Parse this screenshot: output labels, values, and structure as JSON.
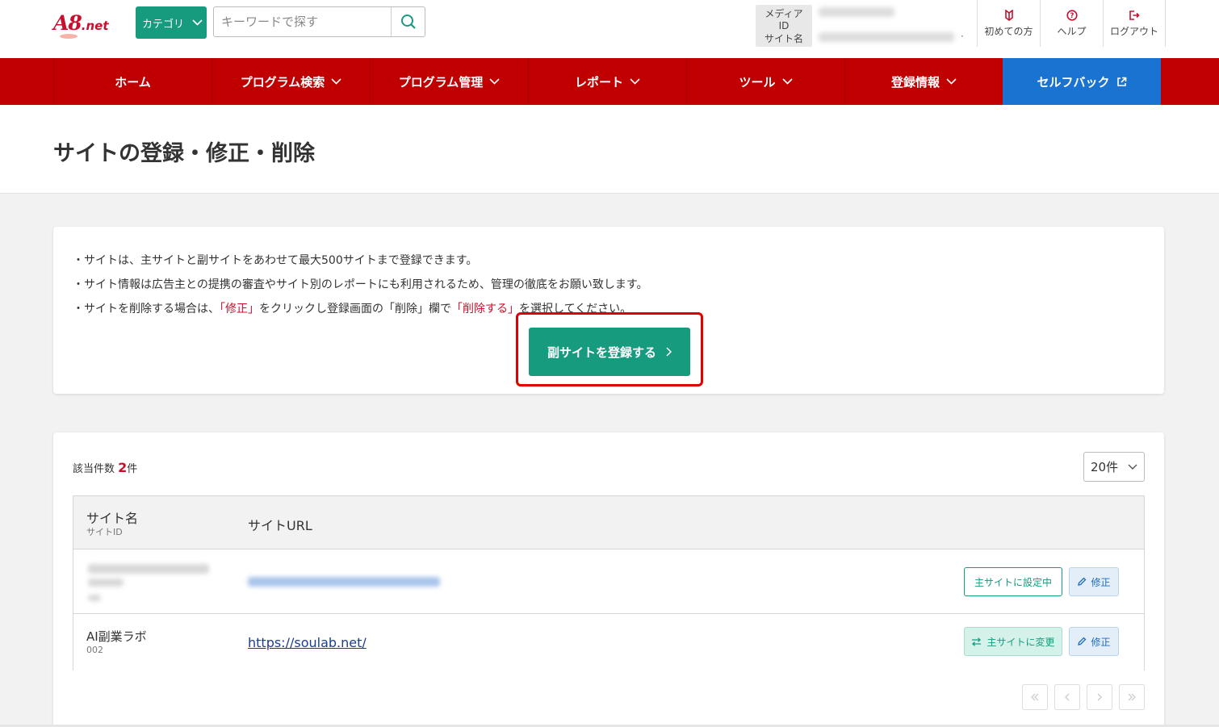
{
  "header": {
    "logo_text": "A8",
    "logo_suffix": ".net",
    "category_label": "カテゴリ",
    "search_placeholder": "キーワードで探す",
    "media_id_label": "メディアID",
    "site_name_label": "サイト名",
    "site_name_ellipsis": "·",
    "links": [
      {
        "label": "初めての方",
        "icon": "beginner-icon"
      },
      {
        "label": "ヘルプ",
        "icon": "help-icon"
      },
      {
        "label": "ログアウト",
        "icon": "logout-icon"
      }
    ]
  },
  "nav": {
    "items": [
      {
        "label": "ホーム",
        "dropdown": false
      },
      {
        "label": "プログラム検索",
        "dropdown": true
      },
      {
        "label": "プログラム管理",
        "dropdown": true
      },
      {
        "label": "レポート",
        "dropdown": true
      },
      {
        "label": "ツール",
        "dropdown": true
      },
      {
        "label": "登録情報",
        "dropdown": true
      }
    ],
    "self_back": {
      "label": "セルフバック",
      "icon": "external-link-icon"
    }
  },
  "page": {
    "title": "サイトの登録・修正・削除"
  },
  "notice": {
    "line1": "・サイトは、主サイトと副サイトをあわせて最大500サイトまで登録できます。",
    "line2": "・サイト情報は広告主との提携の審査やサイト別のレポートにも利用されるため、管理の徹底をお願い致します。",
    "line3_a": "・サイトを削除する場合は、",
    "line3_edit": "「修正」",
    "line3_b": "をクリックし登録画面の「削除」欄で",
    "line3_delete": "「削除する」",
    "line3_c": "を選択してください。",
    "register_button": "副サイトを登録する"
  },
  "results": {
    "count_prefix": "該当件数",
    "count": "2",
    "count_suffix": "件",
    "per_page": "20件",
    "columns": {
      "site_name": "サイト名",
      "site_id": "サイトID",
      "site_url": "サイトURL"
    },
    "rows": [
      {
        "name": "",
        "id": "",
        "url": "",
        "main_action": "主サイトに設定中",
        "edit": "修正"
      },
      {
        "name": "AI副業ラボ",
        "id": "002",
        "url": "https://soulab.net/",
        "main_action": "主サイトに変更",
        "edit": "修正"
      }
    ],
    "pager": [
      "«",
      "‹",
      "›",
      "»"
    ]
  },
  "colors": {
    "brand_red": "#c00000",
    "accent_green": "#169b7f",
    "selfback_blue": "#1a73d0",
    "highlight_red": "#e10000"
  }
}
